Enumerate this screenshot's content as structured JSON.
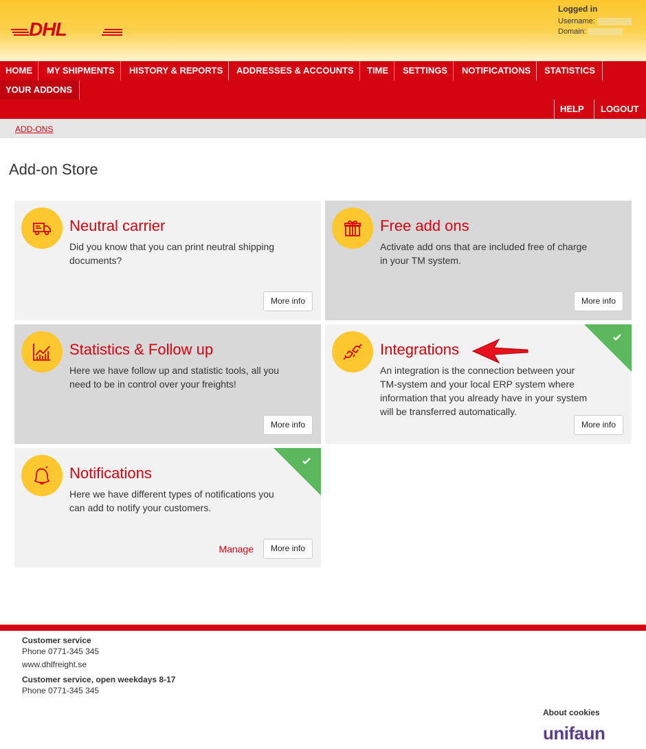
{
  "brand": {
    "logo_text": "DHL",
    "primary": "#d40511",
    "accent": "#fcc72f",
    "active": "#5cb85c"
  },
  "login": {
    "title": "Logged in",
    "username_label": "Username:",
    "domain_label": "Domain:"
  },
  "nav": {
    "row1": [
      "HOME",
      "MY SHIPMENTS",
      "HISTORY & REPORTS",
      "ADDRESSES & ACCOUNTS",
      "TIME",
      "SETTINGS",
      "NOTIFICATIONS",
      "STATISTICS"
    ],
    "row2": [
      "YOUR ADDONS"
    ],
    "right": [
      "HELP",
      "LOGOUT"
    ]
  },
  "breadcrumb": "ADD-ONS",
  "page_title": "Add-on Store",
  "cards": [
    {
      "title": "Neutral carrier",
      "desc": "Did you know that you can print neutral shipping documents?",
      "more": "More info",
      "icon": "truck-icon"
    },
    {
      "title": "Free add ons",
      "desc": "Activate add ons that are included free of charge in your TM system.",
      "more": "More info",
      "icon": "gift-icon"
    },
    {
      "title": "Statistics & Follow up",
      "desc": "Here we have follow up and statistic tools, all you need to be in control over your freights!",
      "more": "More info",
      "icon": "chart-icon"
    },
    {
      "title": "Integrations",
      "desc": "An integration is the connection between your TM-system and your local ERP system where information that you already have in your system will be transferred automatically.",
      "more": "More info",
      "icon": "plug-icon",
      "active": true
    },
    {
      "title": "Notifications",
      "desc": "Here we have different types of notifications you can add to notify your customers.",
      "more": "More info",
      "manage": "Manage",
      "icon": "bell-icon",
      "active": true
    }
  ],
  "footer": {
    "cs_title": "Customer service",
    "cs_phone": "Phone 0771-345 345",
    "cs_web": "www.dhlfreight.se",
    "cs2_title": "Customer service, open weekdays 8-17",
    "cs2_phone": "Phone 0771-345 345",
    "cookies": "About cookies",
    "vendor": "unifaun"
  }
}
